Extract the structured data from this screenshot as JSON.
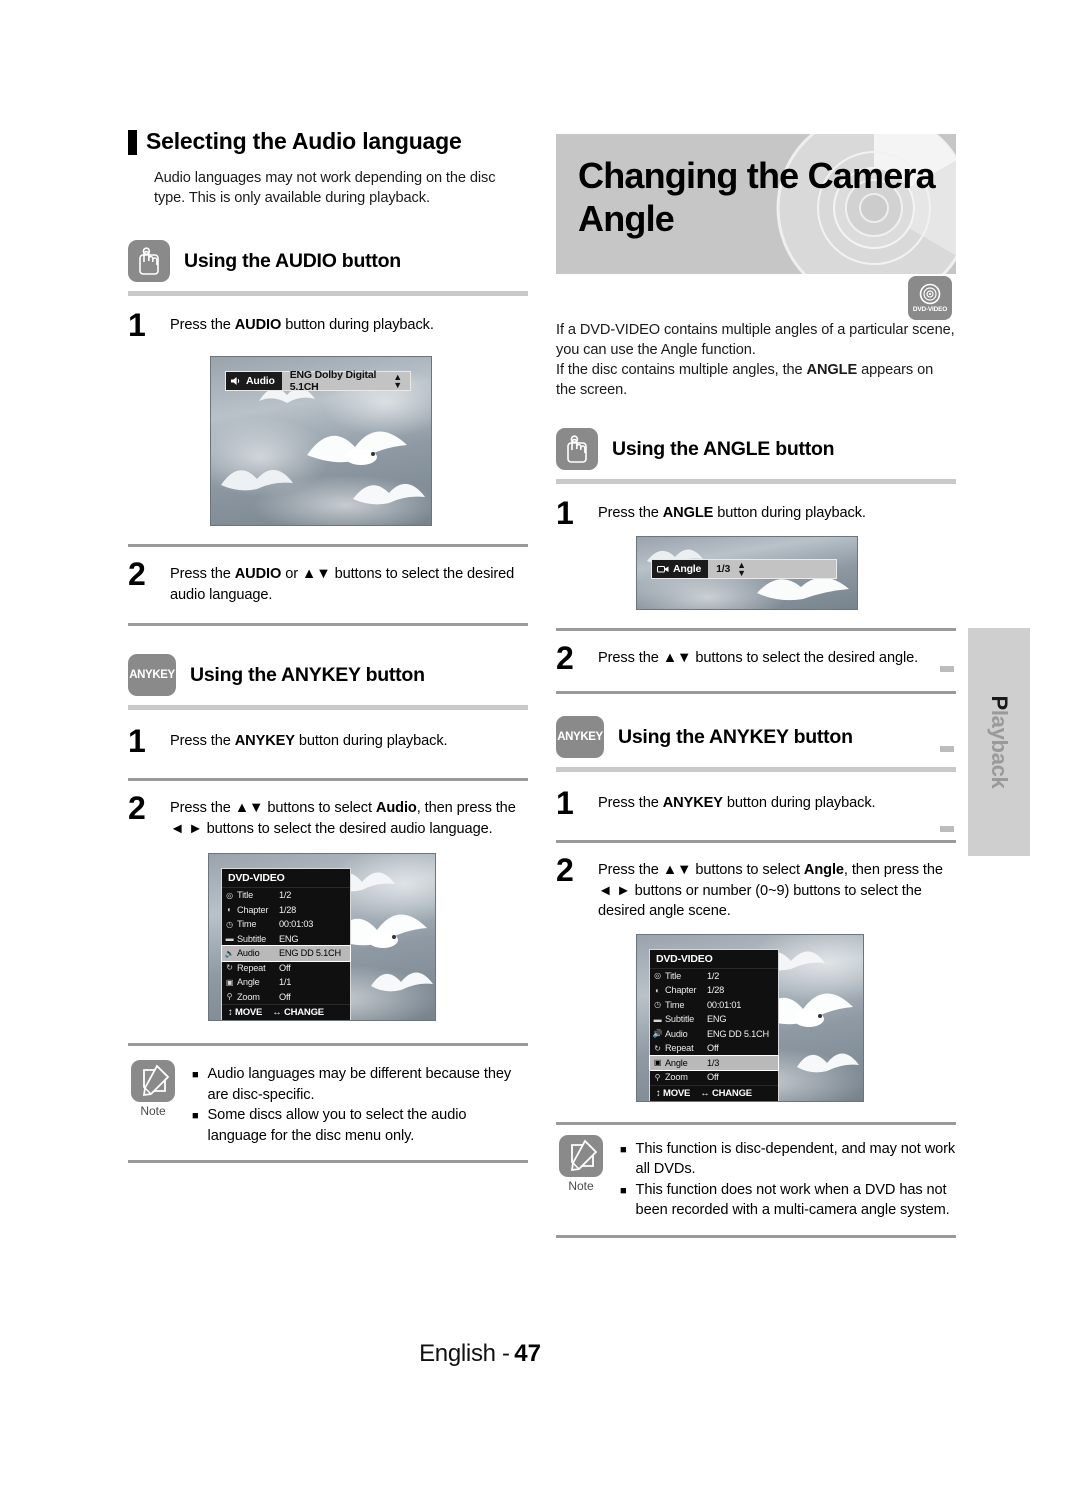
{
  "page": {
    "footer_language": "English -",
    "footer_number": "47",
    "side_tab": "Playback",
    "side_tab_first_letter": "P"
  },
  "left_column": {
    "section_title": "Selecting the Audio language",
    "intro": "Audio languages may not work depending on the disc type. This is only available during playback.",
    "audio_button_section": {
      "icon": "hand-press-button-icon",
      "heading": "Using the AUDIO button",
      "steps": [
        {
          "num": "1",
          "text_before": "Press the ",
          "bold": "AUDIO",
          "text_after": " button during playback."
        },
        {
          "num": "2",
          "text_before": "Press the ",
          "bold": "AUDIO",
          "text_after": " or ▲▼ buttons to select the desired audio language."
        }
      ],
      "osd_banner": {
        "label": "Audio",
        "value": "ENG Dolby Digital 5.1CH",
        "icon": "speaker-icon",
        "stepper": "up-down-arrows"
      }
    },
    "anykey_section": {
      "icon_label": "ANYKEY",
      "heading": "Using the ANYKEY button",
      "steps": [
        {
          "num": "1",
          "text_before": "Press the ",
          "bold": "ANYKEY",
          "text_after": " button during playback."
        },
        {
          "num": "2",
          "text_before": "Press the ▲▼ buttons to select ",
          "bold": "Audio",
          "text_after": ", then press the ◄ ► buttons to select the desired audio language."
        }
      ],
      "osd_menu": {
        "title": "DVD-VIDEO",
        "rows": [
          {
            "icon": "title-icon",
            "name": "Title",
            "value": "1/2",
            "highlighted": false
          },
          {
            "icon": "chapter-icon",
            "name": "Chapter",
            "value": "1/28",
            "highlighted": false
          },
          {
            "icon": "clock-icon",
            "name": "Time",
            "value": "00:01:03",
            "highlighted": false
          },
          {
            "icon": "subtitle-icon",
            "name": "Subtitle",
            "value": "ENG",
            "highlighted": false
          },
          {
            "icon": "speaker-icon",
            "name": "Audio",
            "value": "ENG DD 5.1CH",
            "highlighted": true
          },
          {
            "icon": "repeat-icon",
            "name": "Repeat",
            "value": "Off",
            "highlighted": false
          },
          {
            "icon": "angle-icon",
            "name": "Angle",
            "value": "1/1",
            "highlighted": false
          },
          {
            "icon": "zoom-icon",
            "name": "Zoom",
            "value": "Off",
            "highlighted": false
          }
        ],
        "footer_move": "MOVE",
        "footer_change": "CHANGE"
      }
    },
    "note": {
      "label": "Note",
      "icon": "pencil-note-icon",
      "items": [
        "Audio languages may be different because they are disc-specific.",
        "Some discs allow you to select the audio language for the disc menu only."
      ]
    }
  },
  "right_column": {
    "chapter_title": "Changing the Camera Angle",
    "disc_badge": {
      "icon": "dvd-disc-icon",
      "text": "DVD-VIDEO"
    },
    "intro_1": "If a DVD-VIDEO contains multiple angles of a particular scene, you can use the Angle function.",
    "intro_2_before": "If the disc contains multiple angles, the ",
    "intro_2_bold": "ANGLE",
    "intro_2_after": " appears on the screen.",
    "angle_button_section": {
      "icon": "hand-press-button-icon",
      "heading": "Using the ANGLE button",
      "steps": [
        {
          "num": "1",
          "text_before": "Press the ",
          "bold": "ANGLE",
          "text_after": " button during playback."
        },
        {
          "num": "2",
          "text_before": "Press the ▲▼ buttons to select the desired angle.",
          "bold": "",
          "text_after": ""
        }
      ],
      "osd_banner": {
        "label": "Angle",
        "value": "1/3",
        "icon": "angle-camera-icon",
        "stepper": "up-down-arrows"
      }
    },
    "anykey_section": {
      "icon_label": "ANYKEY",
      "heading": "Using the ANYKEY button",
      "steps": [
        {
          "num": "1",
          "text_before": "Press the ",
          "bold": "ANYKEY",
          "text_after": " button during playback."
        },
        {
          "num": "2",
          "text_before": "Press the ▲▼ buttons to select ",
          "bold": "Angle",
          "text_after": ", then press the ◄ ► buttons or number (0~9) buttons to select the desired angle scene."
        }
      ],
      "osd_menu": {
        "title": "DVD-VIDEO",
        "rows": [
          {
            "icon": "title-icon",
            "name": "Title",
            "value": "1/2",
            "highlighted": false
          },
          {
            "icon": "chapter-icon",
            "name": "Chapter",
            "value": "1/28",
            "highlighted": false
          },
          {
            "icon": "clock-icon",
            "name": "Time",
            "value": "00:01:01",
            "highlighted": false
          },
          {
            "icon": "subtitle-icon",
            "name": "Subtitle",
            "value": "ENG",
            "highlighted": false
          },
          {
            "icon": "speaker-icon",
            "name": "Audio",
            "value": "ENG DD 5.1CH",
            "highlighted": false
          },
          {
            "icon": "repeat-icon",
            "name": "Repeat",
            "value": "Off",
            "highlighted": false
          },
          {
            "icon": "angle-icon",
            "name": "Angle",
            "value": "1/3",
            "highlighted": true
          },
          {
            "icon": "zoom-icon",
            "name": "Zoom",
            "value": "Off",
            "highlighted": false
          }
        ],
        "footer_move": "MOVE",
        "footer_change": "CHANGE"
      }
    },
    "note": {
      "label": "Note",
      "icon": "pencil-note-icon",
      "items": [
        "This function is disc-dependent, and may not work all DVDs.",
        "This function does not work when a DVD has not been recorded with a multi-camera angle system."
      ]
    }
  }
}
